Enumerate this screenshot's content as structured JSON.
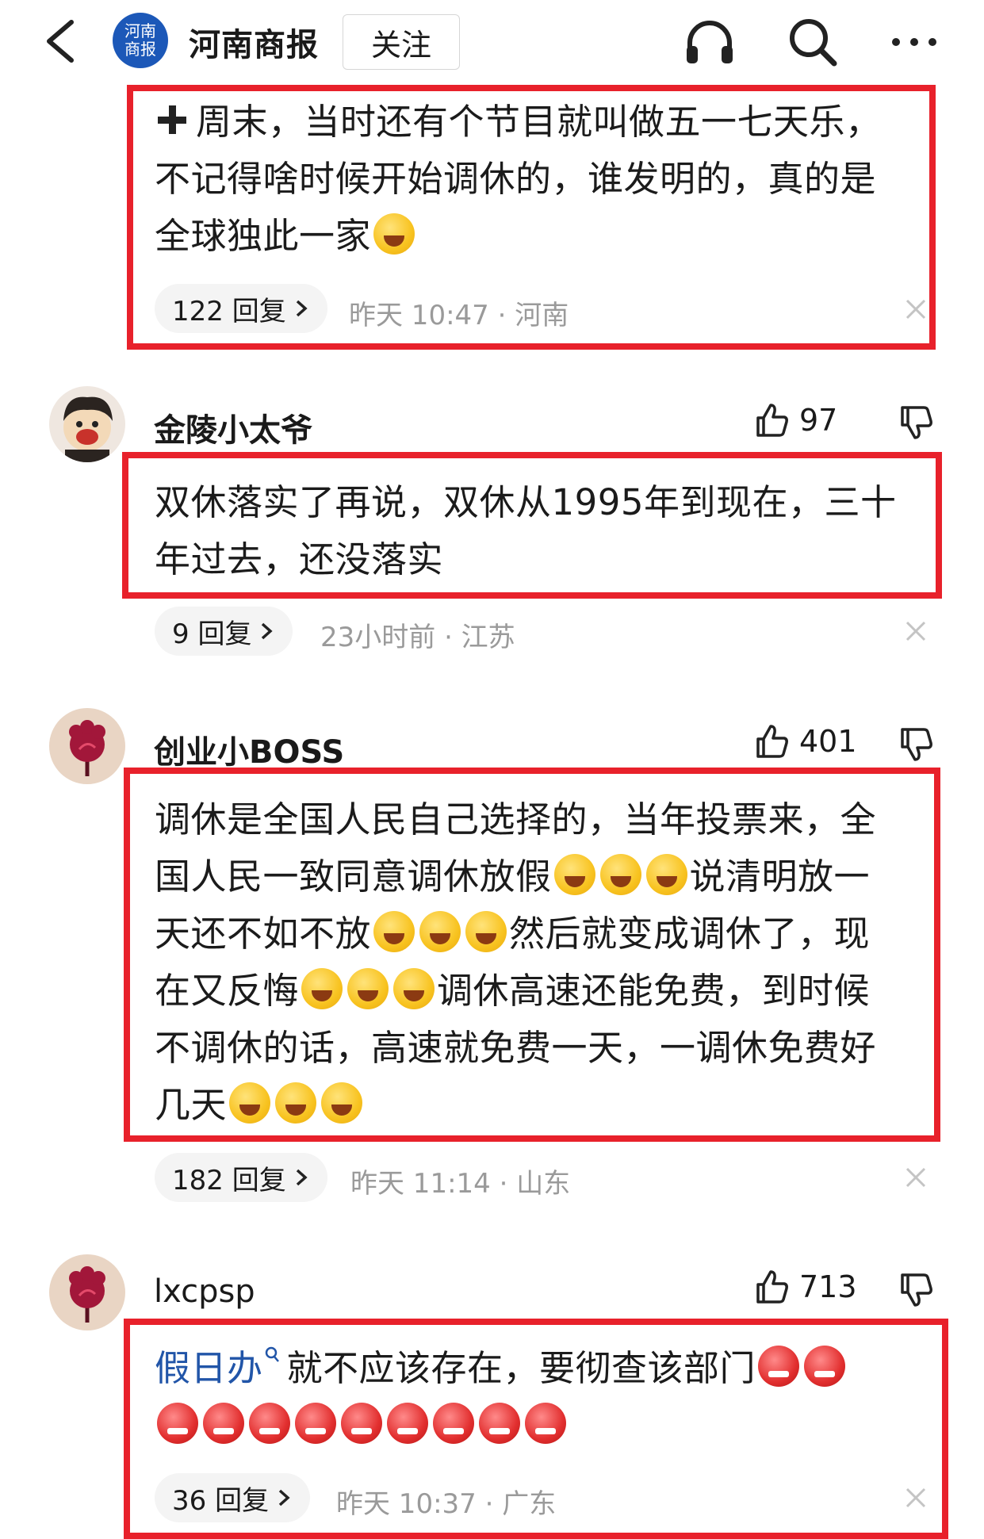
{
  "header": {
    "logo_text_line1": "河南",
    "logo_text_line2": "商报",
    "title": "河南商报",
    "follow_label": "关注"
  },
  "comments": [
    {
      "text_lines": [
        "周末，当时还有个节目就叫做五一七天乐，",
        "不记得啥时候开始调休的，谁发明的，真的是",
        "全球独此一家"
      ],
      "replies": "122 回复",
      "meta": "昨天 10:47 · 河南"
    },
    {
      "username": "金陵小太爷",
      "likes": "97",
      "text_lines": [
        "双休落实了再说，双休从1995年到现在，三十",
        "年过去，还没落实"
      ],
      "replies": "9 回复",
      "meta": "23小时前 · 江苏"
    },
    {
      "username": "创业小BOSS",
      "likes": "401",
      "text_segments": {
        "l1": "调休是全国人民自己选择的，当年投票来，全",
        "l2a": "国人民一致同意调休放假",
        "l2b": "说清明放一",
        "l3a": "天还不如不放",
        "l3b": "然后就变成调休了，现",
        "l4a": "在又反悔",
        "l4b": "调休高速还能免费，到时候",
        "l5": "不调休的话，高速就免费一天，一调休免费好",
        "l6": "几天"
      },
      "replies": "182 回复",
      "meta": "昨天 11:14 · 山东"
    },
    {
      "username": "lxcpsp",
      "likes": "713",
      "link_text": "假日办",
      "text_rest": "就不应该存在，要彻查该部门",
      "replies": "36 回复",
      "meta": "昨天 10:37 · 广东"
    }
  ],
  "icons": {
    "emoji_laugh": "laughing-crying-emoji",
    "emoji_angry": "angry-emoji"
  }
}
